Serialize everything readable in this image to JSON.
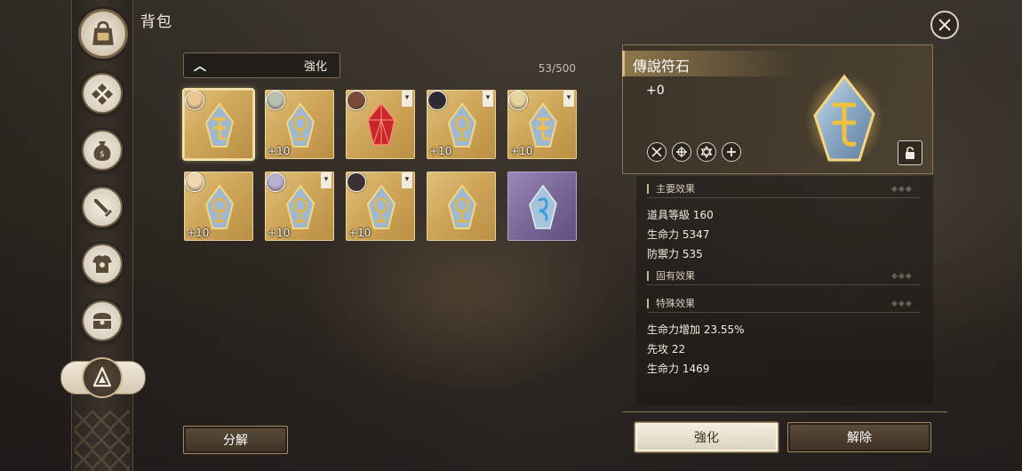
{
  "header": {
    "title": "背包"
  },
  "filter": {
    "selected": "強化"
  },
  "inventory": {
    "count": "53/500",
    "slots": [
      {
        "level": "",
        "avatar_color": "#e8c890",
        "selected": true,
        "rune": "gold-rune",
        "locked": false
      },
      {
        "level": "+10",
        "avatar_color": "#b8c0b0",
        "selected": false,
        "rune": "blue-rune",
        "locked": false
      },
      {
        "level": "",
        "avatar_color": "#7a4a38",
        "selected": false,
        "rune": "red-crystal",
        "locked": true
      },
      {
        "level": "+10",
        "avatar_color": "#2c2a30",
        "selected": false,
        "rune": "blue-rune",
        "locked": true
      },
      {
        "level": "+10",
        "avatar_color": "#e8d4a0",
        "selected": false,
        "rune": "gold-rune",
        "locked": true
      },
      {
        "level": "+10",
        "avatar_color": "#f0d8b0",
        "selected": false,
        "rune": "blue-rune",
        "locked": false
      },
      {
        "level": "+10",
        "avatar_color": "#b8b0d0",
        "selected": false,
        "rune": "blue-rune",
        "locked": true
      },
      {
        "level": "+10",
        "avatar_color": "#3a3034",
        "selected": false,
        "rune": "blue-rune",
        "locked": true
      },
      {
        "level": "",
        "avatar_color": "",
        "selected": false,
        "rune": "blue-rune",
        "locked": false
      },
      {
        "level": "",
        "avatar_color": "",
        "selected": false,
        "rune": "ice-rune",
        "locked": false
      }
    ]
  },
  "detail": {
    "name": "傳說符石",
    "level": "+0",
    "stat_icons": [
      "crossed-swords-icon",
      "bow-icon",
      "star-of-david-icon",
      "plus-icon"
    ],
    "main_effects_label": "主要效果",
    "main_effects": [
      "道具等級 160",
      "生命力 5347",
      "防禦力 535"
    ],
    "innate_effects_label": "固有效果",
    "special_effects_label": "特殊效果",
    "special_effects": [
      "生命力增加 23.55%",
      "先攻 22",
      "生命力 1469"
    ],
    "section_ornament": "◆◆◆"
  },
  "buttons": {
    "decompose": "分解",
    "enhance": "強化",
    "remove": "解除"
  },
  "sidebar": {
    "items": [
      "bag-icon",
      "diamond-grid-icon",
      "pouch-icon",
      "sword-icon",
      "armor-icon",
      "chest-icon",
      "rune-icon"
    ]
  }
}
